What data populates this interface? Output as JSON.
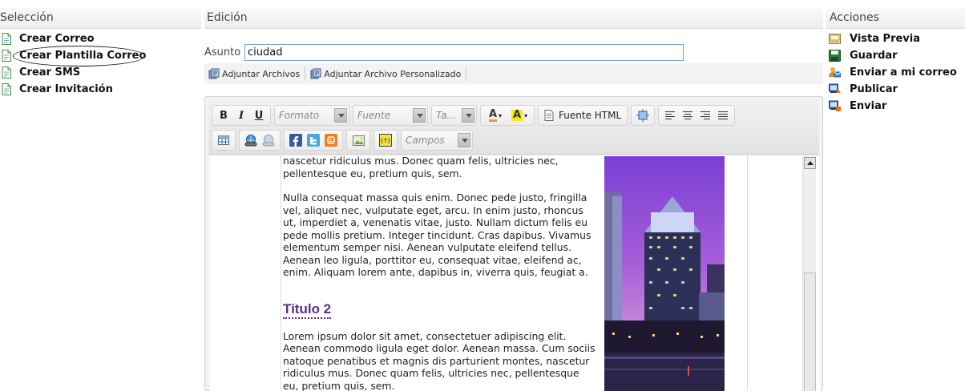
{
  "left_panel": {
    "title": "Selección",
    "items": [
      {
        "label": "Crear Correo",
        "icon": "document-icon"
      },
      {
        "label": "Crear Plantilla Correo",
        "icon": "document-icon"
      },
      {
        "label": "Crear SMS",
        "icon": "document-icon"
      },
      {
        "label": "Crear Invitación",
        "icon": "document-icon"
      }
    ]
  },
  "center_panel": {
    "title": "Edición",
    "asunto_label": "Asunto",
    "asunto_value": "ciudad",
    "attach": [
      "Adjuntar Archivos",
      "Adjuntar Archivo Personalizado"
    ],
    "toolbar": {
      "bold": "B",
      "italic": "I",
      "underline": "U",
      "format_placeholder": "Formato",
      "font_placeholder": "Fuente",
      "size_placeholder": "Ta...",
      "text_color": "A",
      "bg_color": "A",
      "html_source": "Fuente HTML",
      "fields_placeholder": "Campos"
    },
    "content": {
      "p1": "nascetur ridiculus mus. Donec quam felis, ultricies nec, pellentesque eu, pretium quis, sem.",
      "p2": "Nulla consequat massa quis enim. Donec pede justo, fringilla vel, aliquet nec, vulputate eget, arcu. In enim justo, rhoncus ut, imperdiet a, venenatis vitae, justo. Nullam dictum felis eu pede mollis pretium. Integer tincidunt. Cras dapibus. Vivamus elementum semper nisi. Aenean vulputate eleifend tellus. Aenean leo ligula, porttitor eu, consequat vitae, eleifend ac, enim. Aliquam lorem ante, dapibus in, viverra quis, feugiat a.",
      "heading": "Titulo 2",
      "p3": "Lorem ipsum dolor sit amet, consectetuer adipiscing elit. Aenean commodo ligula eget dolor. Aenean massa. Cum sociis natoque penatibus et magnis dis parturient montes, nascetur ridiculus mus. Donec quam felis, ultricies nec, pellentesque eu, pretium quis, sem."
    },
    "heading_color": "#5a2d8a"
  },
  "right_panel": {
    "title": "Acciones",
    "items": [
      {
        "label": "Vista Previa",
        "icon": "preview-icon"
      },
      {
        "label": "Guardar",
        "icon": "save-icon"
      },
      {
        "label": "Enviar a mi correo",
        "icon": "send-to-me-icon"
      },
      {
        "label": "Publicar",
        "icon": "publish-icon"
      },
      {
        "label": "Enviar",
        "icon": "send-icon"
      }
    ]
  }
}
